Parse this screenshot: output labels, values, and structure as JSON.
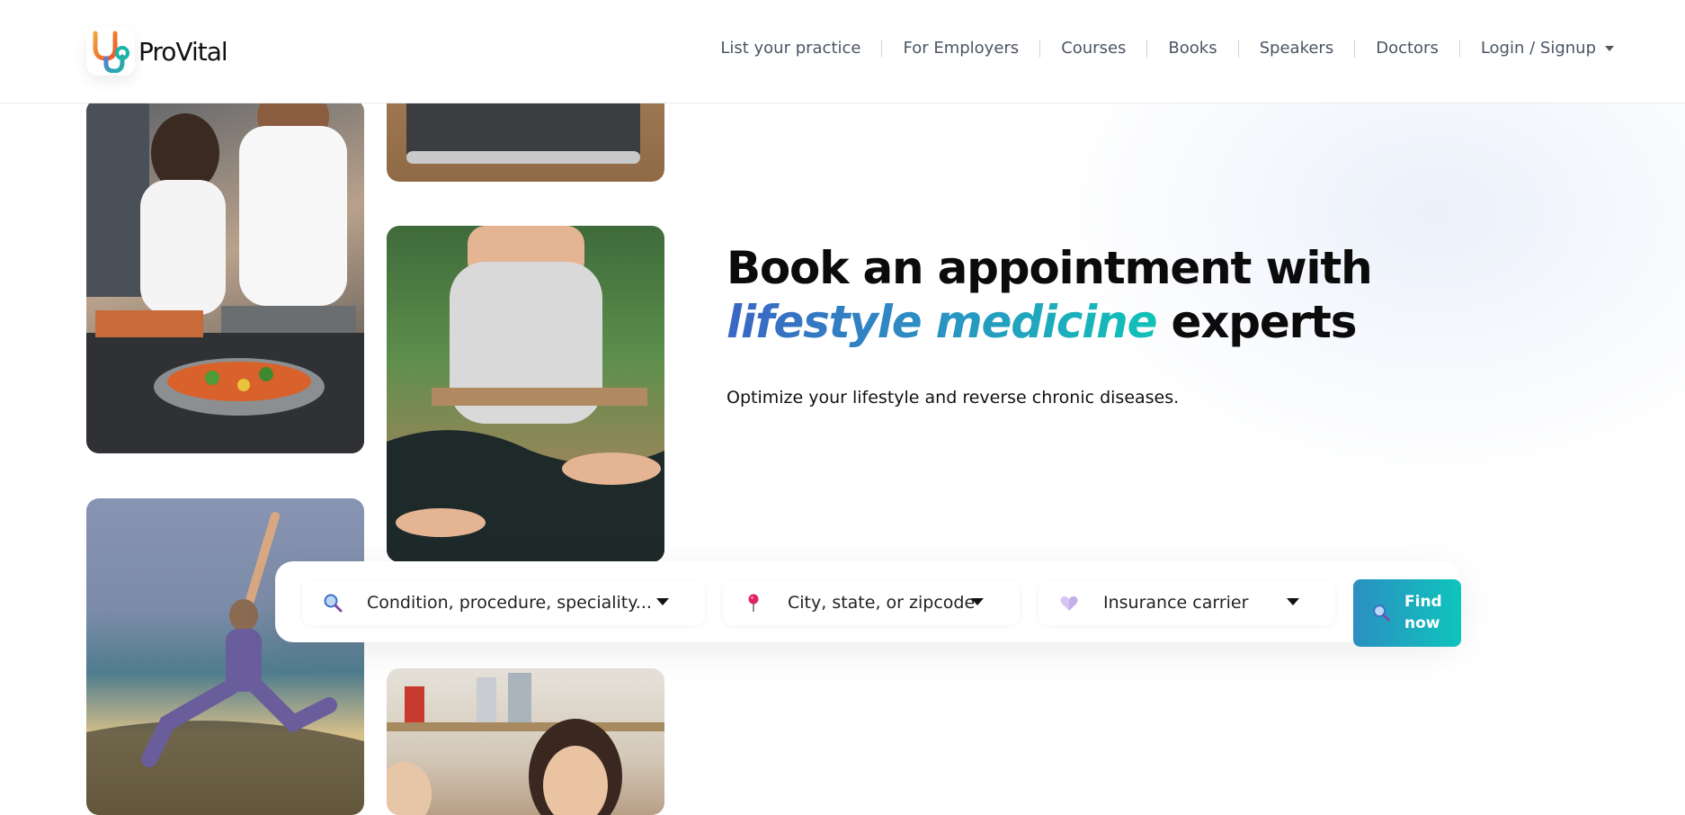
{
  "brand": {
    "name": "ProVital"
  },
  "nav": {
    "items": [
      "List your practice",
      "For Employers",
      "Courses",
      "Books",
      "Speakers",
      "Doctors",
      "Login / Signup"
    ]
  },
  "hero": {
    "title_line1": "Book an appointment with",
    "title_accent": "lifestyle medicine",
    "title_end": " experts",
    "subtitle": "Optimize your lifestyle and reverse chronic diseases."
  },
  "search": {
    "condition_placeholder": "Condition, procedure, speciality...",
    "location_placeholder": "City, state, or zipcode",
    "insurance_placeholder": "Insurance carrier",
    "find_label": "Find now"
  },
  "icons": {
    "search": "magnifier-icon",
    "location": "pin-icon",
    "insurance": "heart-icon",
    "dropdown": "caret-down-icon"
  },
  "colors": {
    "accent_start": "#3a66c4",
    "accent_end": "#10c2b7",
    "button_start": "#2b8fc1",
    "button_end": "#0ec4bc",
    "logo_orange": "#f28c28",
    "logo_teal": "#19b5a5"
  }
}
